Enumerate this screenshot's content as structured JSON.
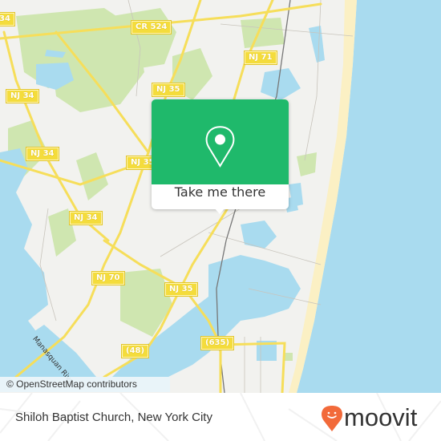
{
  "map": {
    "attribution": "© OpenStreetMap contributors",
    "river_label": "Manasquan River",
    "road_shields": [
      {
        "id": "cr524",
        "label": "CR 524"
      },
      {
        "id": "nj34-top",
        "label": "34"
      },
      {
        "id": "nj35-top",
        "label": "NJ 35"
      },
      {
        "id": "nj71",
        "label": "NJ 71"
      },
      {
        "id": "nj34-a",
        "label": "NJ 34"
      },
      {
        "id": "nj34-b",
        "label": "NJ 34"
      },
      {
        "id": "nj35-mid",
        "label": "NJ 35"
      },
      {
        "id": "nj34-c",
        "label": "NJ 34"
      },
      {
        "id": "nj70",
        "label": "NJ 70"
      },
      {
        "id": "nj35-low",
        "label": "NJ 35"
      },
      {
        "id": "r48",
        "label": "(48)"
      },
      {
        "id": "r635",
        "label": "(635)"
      }
    ],
    "colors": {
      "land": "#f2f2ef",
      "water": "#a9dbef",
      "park": "#cfe6b0",
      "road": "#f6de5a",
      "beach": "#fbf0c4"
    }
  },
  "popup": {
    "button_label": "Take me there",
    "icon": "location-pin-icon",
    "color": "#1fb96b"
  },
  "footer": {
    "place_name": "Shiloh Baptist Church, New York City",
    "brand_name": "moovit",
    "brand_color": "#f26a3a"
  }
}
